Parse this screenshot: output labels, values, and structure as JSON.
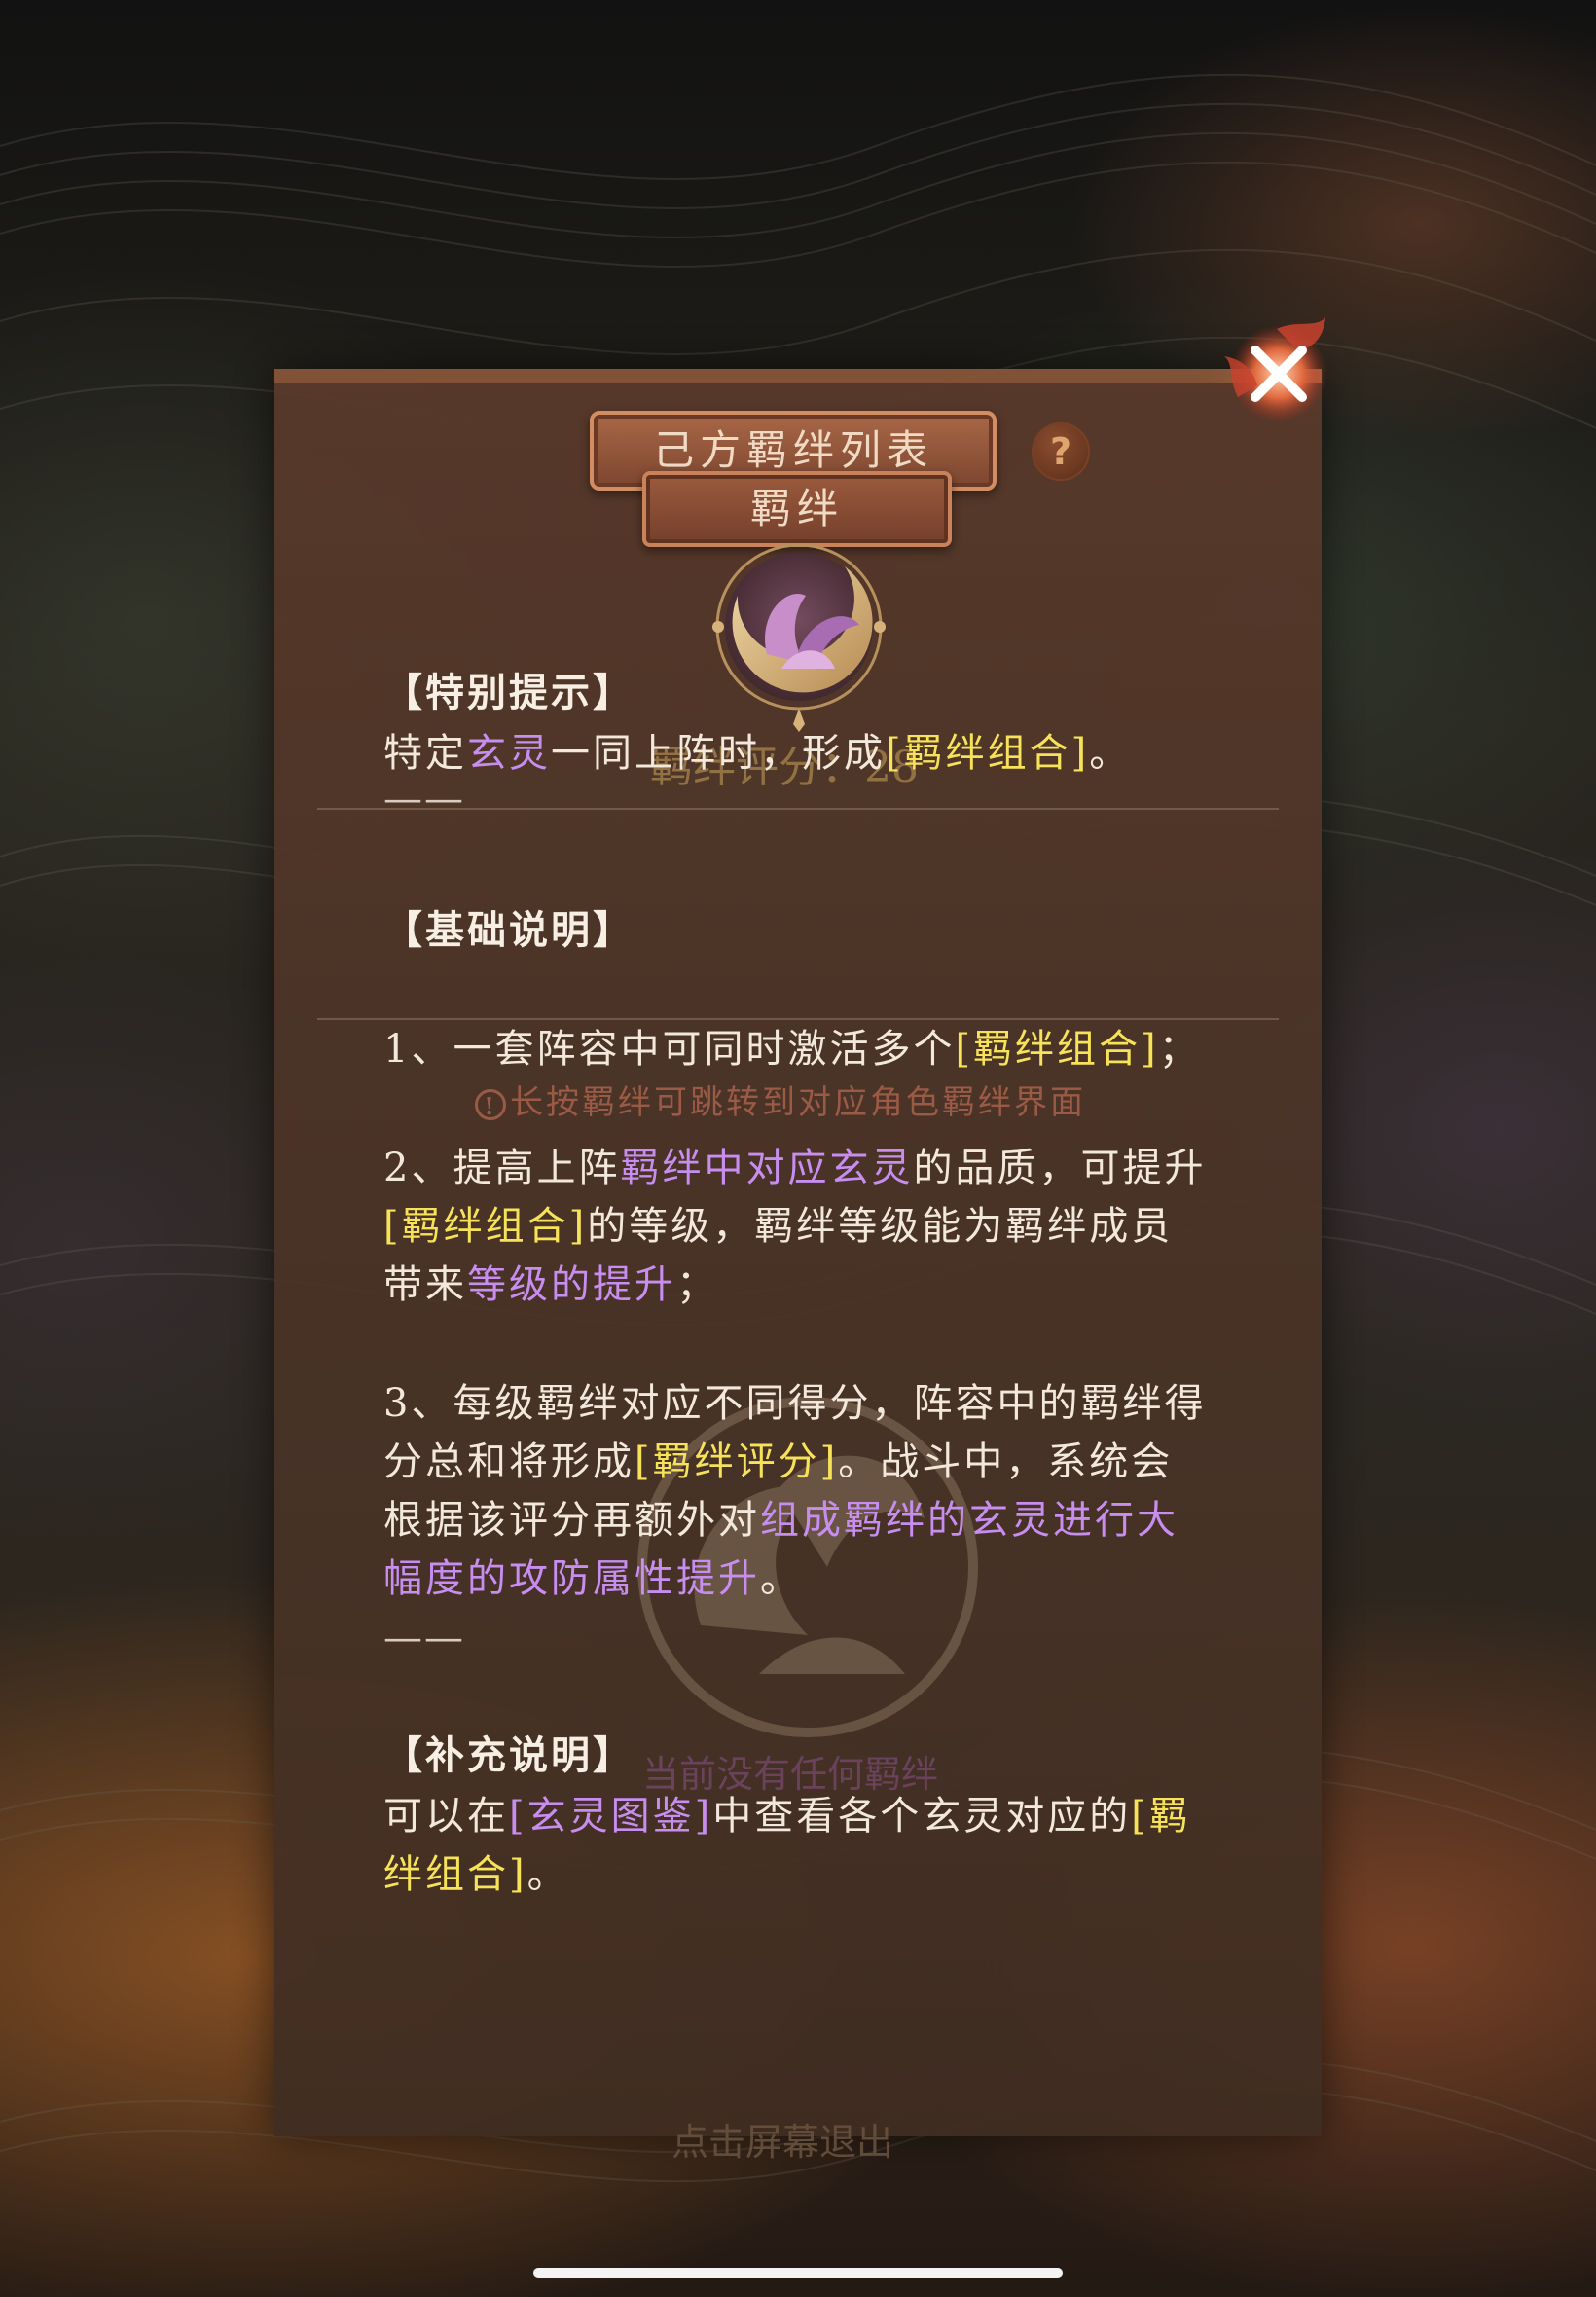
{
  "header": {
    "title": "己方羁绊列表",
    "subtitle": "羁绊",
    "help_label": "?"
  },
  "background_ghost": {
    "score_text": "羁绊评分：28",
    "empty_text": "当前没有任何羁绊",
    "exit_text": "点击屏幕退出"
  },
  "sections": {
    "special": {
      "heading": "【特别提示】",
      "line1": [
        {
          "text": "特定",
          "style": "plain"
        },
        {
          "text": "玄灵",
          "style": "purple"
        },
        {
          "text": "一同上阵时，形成",
          "style": "plain"
        },
        {
          "text": "[羁绊组合]",
          "style": "yellow"
        },
        {
          "text": "。",
          "style": "plain"
        }
      ],
      "dash": "——"
    },
    "basic": {
      "heading": "【基础说明】",
      "item1": [
        {
          "text": "1、一套阵容中可同时激活多个",
          "style": "plain"
        },
        {
          "text": "[羁绊组合]",
          "style": "yellow"
        },
        {
          "text": "；",
          "style": "plain"
        }
      ],
      "hint_icon": "!",
      "hint": "长按羁绊可跳转到对应角色羁绊界面",
      "item2_line1": [
        {
          "text": "2、提高上阵",
          "style": "plain"
        },
        {
          "text": "羁绊中对应玄灵",
          "style": "purple"
        },
        {
          "text": "的品质，可提升",
          "style": "plain"
        }
      ],
      "item2_line2": [
        {
          "text": "[羁绊组合]",
          "style": "yellow"
        },
        {
          "text": "的等级，羁绊等级能为羁绊成员",
          "style": "plain"
        }
      ],
      "item2_line3": [
        {
          "text": "带来",
          "style": "plain"
        },
        {
          "text": "等级的提升",
          "style": "purple"
        },
        {
          "text": "；",
          "style": "plain"
        }
      ],
      "item3_line1": [
        {
          "text": "3、每级羁绊对应不同得分，阵容中的羁绊得",
          "style": "plain"
        }
      ],
      "item3_line2": [
        {
          "text": "分总和将形成",
          "style": "plain"
        },
        {
          "text": "[羁绊评分]",
          "style": "yellow"
        },
        {
          "text": "。战斗中，系统会",
          "style": "plain"
        }
      ],
      "item3_line3": [
        {
          "text": "根据该评分再额外对",
          "style": "plain"
        },
        {
          "text": "组成羁绊的玄灵进行大",
          "style": "purple"
        }
      ],
      "item3_line4": [
        {
          "text": "幅度的攻防属性提升",
          "style": "purple"
        },
        {
          "text": "。",
          "style": "plain"
        }
      ],
      "dash": "——"
    },
    "supplement": {
      "heading": "【补充说明】",
      "line1": [
        {
          "text": "可以在",
          "style": "plain"
        },
        {
          "text": "[玄灵图鉴]",
          "style": "purple"
        },
        {
          "text": "中查看各个玄灵对应的",
          "style": "plain"
        },
        {
          "text": "[羁",
          "style": "yellow"
        }
      ],
      "line2": [
        {
          "text": "绊组合]",
          "style": "yellow"
        },
        {
          "text": "。",
          "style": "plain"
        }
      ]
    }
  },
  "colors": {
    "highlight_yellow": "#f7e35a",
    "highlight_purple": "#c78ef0",
    "body_text": "#f2e8dc",
    "panel_brown": "#4d3528"
  },
  "icons": {
    "close": "close-x-icon",
    "help": "question-mark-icon",
    "emblem": "lotus-moon-emblem-icon",
    "hint": "exclamation-circle-icon"
  }
}
